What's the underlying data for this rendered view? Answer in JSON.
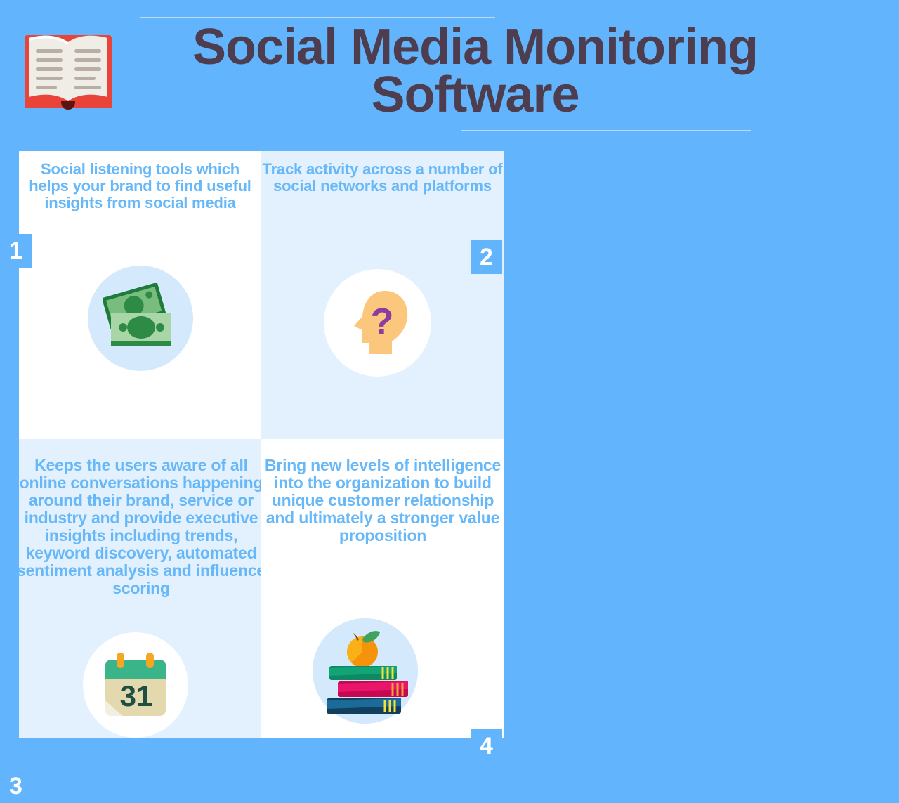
{
  "page": {
    "background_color": "#62b5fc",
    "title": "Social Media Monitoring Software",
    "title_color": "#4e3d4f",
    "accent_color": "#62b5fc",
    "card_text_color": "#67b8f8",
    "rule_color": "#b9dcfb",
    "header_icon": "open-book-icon"
  },
  "cards": [
    {
      "number": "1",
      "text": "Social listening tools which helps your brand to find useful insights from social media",
      "background": "#ffffff",
      "badge_side": "left",
      "icon": "money-banknotes-icon",
      "icon_circle_color": "#d4e9fb"
    },
    {
      "number": "2",
      "text": "Track activity across a number of social networks and platforms",
      "background": "#e3f0fd",
      "badge_side": "right",
      "icon": "head-question-mark-icon",
      "icon_circle_color": "#ffffff"
    },
    {
      "number": "3",
      "text": "Keeps the users aware of all online conversations happening around their brand, service or industry and provide executive insights including trends, keyword discovery, automated sentiment analysis and influence scoring",
      "background": "#e3f0fd",
      "badge_side": "left",
      "icon": "calendar-icon",
      "icon_circle_color": "#ffffff",
      "icon_label": "31"
    },
    {
      "number": "4",
      "text": "Bring new levels of intelligence into the organization to build unique customer relationship and ultimately a stronger value proposition",
      "background": "#ffffff",
      "badge_side": "right",
      "icon": "books-stack-with-orange-icon",
      "icon_circle_color": "#d4e9fb"
    }
  ]
}
